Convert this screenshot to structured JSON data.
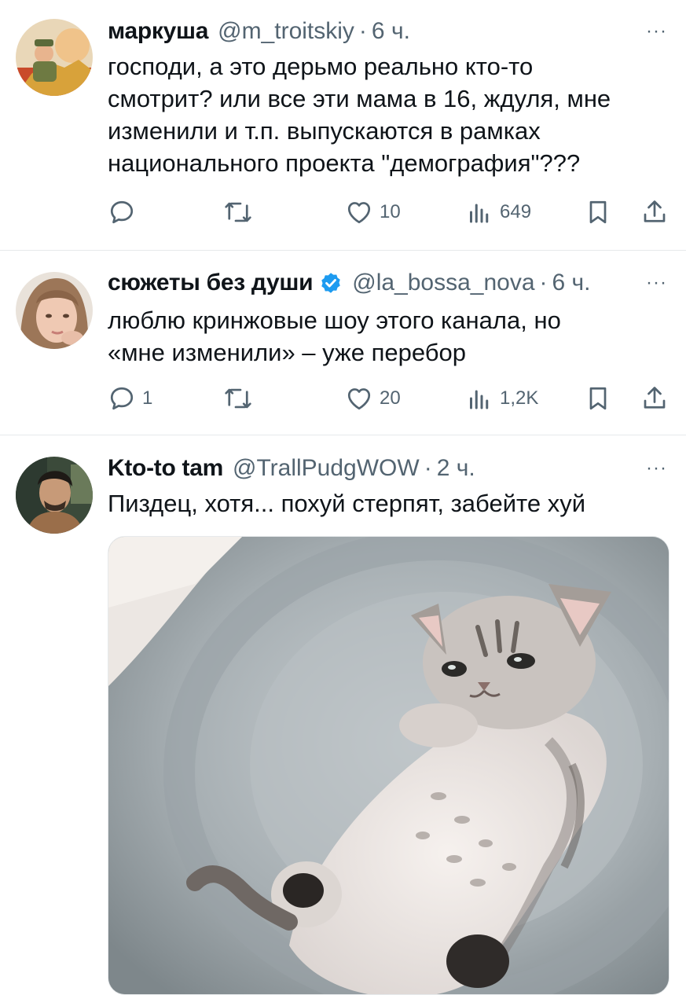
{
  "tweets": [
    {
      "name": "маркуша",
      "handle": "@m_troitskiy",
      "separator": "·",
      "time": "6 ч.",
      "more": "···",
      "lines": [
        "господи, а это дерьмо реально кто-то",
        "смотрит? или все эти мама в 16, ждуля, мне",
        "изменили и т.п. выпускаются в рамках",
        "национального проекта \"демография\"???"
      ],
      "reply_count": "",
      "retweet_count": "",
      "like_count": "10",
      "view_count": "649"
    },
    {
      "name": "сюжеты без души",
      "handle": "@la_bossa_nova",
      "separator": "·",
      "time": "6 ч.",
      "more": "···",
      "verified": true,
      "lines": [
        "люблю кринжовые шоу этого канала, но",
        "«мне изменили» – уже перебор"
      ],
      "reply_count": "1",
      "retweet_count": "",
      "like_count": "20",
      "view_count": "1,2K"
    },
    {
      "name": "Kto-to tam",
      "handle": "@TrallPudgWOW",
      "separator": "·",
      "time": "2 ч.",
      "more": "···",
      "lines": [
        "Пиздец, хотя... похуй стерпят, забейте хуй"
      ],
      "media": "kitten-photo"
    }
  ],
  "colors": {
    "text": "#0f1419",
    "secondary": "#536471",
    "verified": "#1d9bf0",
    "divider": "#e6e9eb"
  },
  "icons": [
    "reply-icon",
    "retweet-icon",
    "like-icon",
    "views-icon",
    "bookmark-icon",
    "share-icon",
    "more-icon",
    "verified-badge-icon"
  ]
}
